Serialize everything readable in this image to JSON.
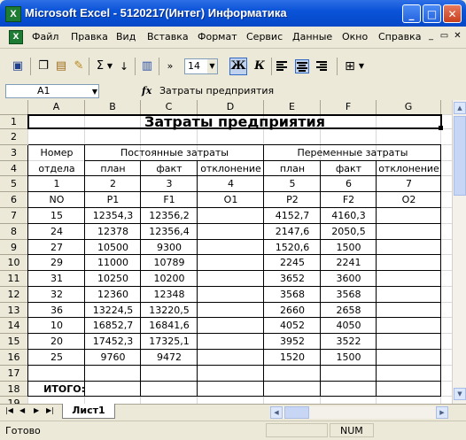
{
  "window": {
    "title": "Microsoft Excel - 5120217(Интег) Информатика",
    "app_icon": "X"
  },
  "menu": [
    "Файл",
    "Правка",
    "Вид",
    "Вставка",
    "Формат",
    "Сервис",
    "Данные",
    "Окно",
    "Справка"
  ],
  "toolbar": {
    "sigma": "Σ",
    "font_size": "14",
    "bold": "Ж",
    "italic": "К",
    "more": "»"
  },
  "formula_bar": {
    "name_box": "A1",
    "fx": "fx",
    "content": "Затраты предприятия"
  },
  "columns": [
    "A",
    "B",
    "C",
    "D",
    "E",
    "F",
    "G"
  ],
  "rows": [
    "1",
    "2",
    "3",
    "4",
    "5",
    "6",
    "7",
    "8",
    "9",
    "10",
    "11",
    "12",
    "13",
    "14",
    "15",
    "16",
    "17",
    "18",
    "19"
  ],
  "sheet": {
    "title": "Затраты предприятия",
    "hdr_nomer": "Номер",
    "hdr_otdela": "отдела",
    "hdr_postoyannye": "Постоянные затраты",
    "hdr_peremennye": "Переменные затраты",
    "hdr_plan": "план",
    "hdr_fakt": "факт",
    "hdr_otklonenie": "отклонение",
    "r5": [
      "1",
      "2",
      "3",
      "4",
      "5",
      "6",
      "7"
    ],
    "r6": [
      "NO",
      "P1",
      "F1",
      "O1",
      "P2",
      "F2",
      "O2"
    ],
    "data": [
      [
        "15",
        "12354,3",
        "12356,2",
        "",
        "4152,7",
        "4160,3",
        ""
      ],
      [
        "24",
        "12378",
        "12356,4",
        "",
        "2147,6",
        "2050,5",
        ""
      ],
      [
        "27",
        "10500",
        "9300",
        "",
        "1520,6",
        "1500",
        ""
      ],
      [
        "29",
        "11000",
        "10789",
        "",
        "2245",
        "2241",
        ""
      ],
      [
        "31",
        "10250",
        "10200",
        "",
        "3652",
        "3600",
        ""
      ],
      [
        "32",
        "12360",
        "12348",
        "",
        "3568",
        "3568",
        ""
      ],
      [
        "36",
        "13224,5",
        "13220,5",
        "",
        "2660",
        "2658",
        ""
      ],
      [
        "10",
        "16852,7",
        "16841,6",
        "",
        "4052",
        "4050",
        ""
      ],
      [
        "20",
        "17452,3",
        "17325,1",
        "",
        "3952",
        "3522",
        ""
      ],
      [
        "25",
        "9760",
        "9472",
        "",
        "1520",
        "1500",
        ""
      ]
    ],
    "itogo": "ИТОГО:"
  },
  "sheet_tabs": {
    "active": "Лист1"
  },
  "status": {
    "ready": "Готово",
    "num": "NUM"
  }
}
